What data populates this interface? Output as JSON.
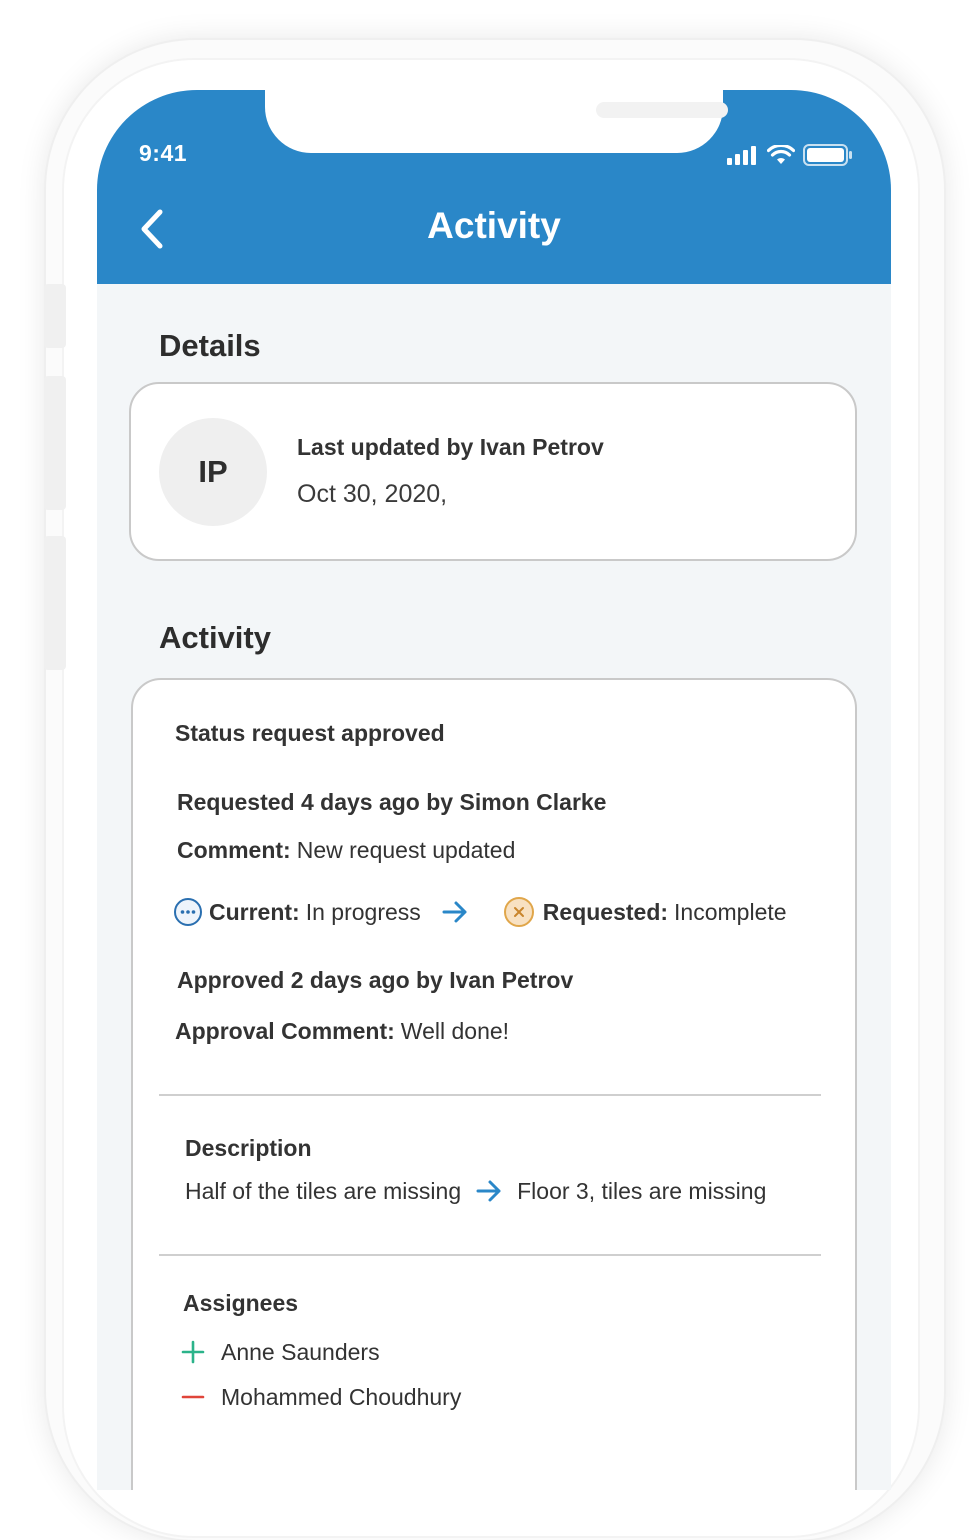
{
  "status_bar": {
    "time": "9:41"
  },
  "nav": {
    "title": "Activity"
  },
  "details": {
    "section_title": "Details",
    "avatar_initials": "IP",
    "updated_by": "Last updated by Ivan Petrov",
    "updated_date": "Oct 30, 2020,"
  },
  "activity": {
    "section_title": "Activity",
    "status_title": "Status request approved",
    "requested_line": "Requested 4 days ago by Simon Clarke",
    "comment_label": "Comment:",
    "comment_value": "New request updated",
    "current_label": "Current:",
    "current_value": "In progress",
    "requested_label": "Requested:",
    "requested_value": "Incomplete",
    "approved_line": "Approved 2 days ago by Ivan Petrov",
    "approval_label": "Approval Comment:",
    "approval_value": "Well done!",
    "description_title": "Description",
    "description_old": "Half of the tiles are missing",
    "description_new": "Floor 3, tiles are missing",
    "assignees_title": "Assignees",
    "assignee_added": "Anne Saunders",
    "assignee_removed": "Mohammed Choudhury"
  },
  "colors": {
    "header_blue": "#2a87c8",
    "arrow_blue": "#2a87c8",
    "in_progress_ring": "#2a6fb0",
    "incomplete_fill": "#f8e1c2",
    "incomplete_ring": "#e0a64a",
    "added_green": "#2bb38a",
    "removed_red": "#e0453a"
  },
  "icons": {
    "back": "chevron-left-icon",
    "signal": "signal-bars-icon",
    "wifi": "wifi-icon",
    "battery": "battery-icon",
    "in_progress": "ellipsis-circle-icon",
    "incomplete": "x-circle-icon",
    "arrow": "arrow-right-icon",
    "added": "plus-icon",
    "removed": "minus-icon"
  }
}
